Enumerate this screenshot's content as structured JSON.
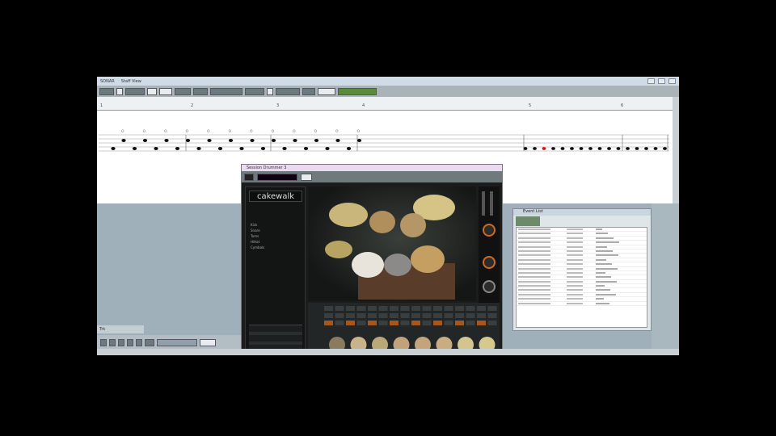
{
  "app": {
    "title": "SONAR",
    "doc_title": "Staff View"
  },
  "ruler": {
    "marks": [
      "1",
      "2",
      "3",
      "4",
      "5",
      "6"
    ]
  },
  "drum_plugin": {
    "title": "Session Drummer 3",
    "logo": "cakewalk",
    "menu_items": [
      "Kick",
      "Snare",
      "Toms",
      "HiHat",
      "Cymbals"
    ]
  },
  "event_list": {
    "title": "Event List"
  },
  "tracks_tab": {
    "label": "Trk"
  }
}
